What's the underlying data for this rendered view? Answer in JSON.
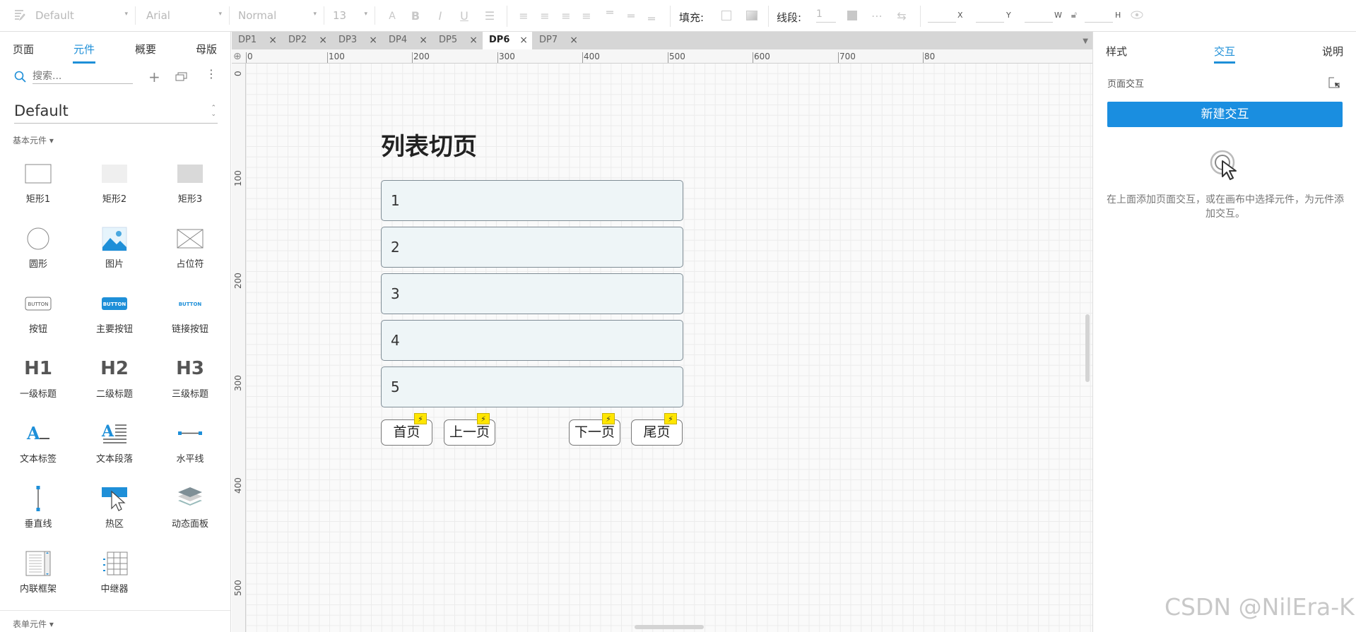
{
  "toolbar": {
    "style_value": "Default",
    "font_value": "Arial",
    "weight_value": "Normal",
    "size_value": "13",
    "fill_label": "填充:",
    "line_label": "线段:",
    "line_value": "1",
    "x_label": "X",
    "y_label": "Y",
    "w_label": "W",
    "h_label": "H"
  },
  "left": {
    "tabs": [
      {
        "label": "页面"
      },
      {
        "label": "元件"
      },
      {
        "label": "概要"
      },
      {
        "label": "母版"
      }
    ],
    "search_placeholder": "搜索...",
    "library_name": "Default",
    "section_basic": "基本元件 ▾",
    "section_form": "表单元件 ▾",
    "widgets": [
      {
        "label": "矩形1",
        "icon": "rect1-icon"
      },
      {
        "label": "矩形2",
        "icon": "rect2-icon"
      },
      {
        "label": "矩形3",
        "icon": "rect3-icon"
      },
      {
        "label": "圆形",
        "icon": "circle-icon"
      },
      {
        "label": "图片",
        "icon": "image-icon"
      },
      {
        "label": "占位符",
        "icon": "placeholder-icon"
      },
      {
        "label": "按钮",
        "icon": "button-icon",
        "glyph": "BUTTON"
      },
      {
        "label": "主要按钮",
        "icon": "primary-button-icon",
        "glyph": "BUTTON"
      },
      {
        "label": "链接按钮",
        "icon": "link-button-icon",
        "glyph": "BUTTON"
      },
      {
        "label": "一级标题",
        "icon": "h1-icon",
        "glyph": "H1"
      },
      {
        "label": "二级标题",
        "icon": "h2-icon",
        "glyph": "H2"
      },
      {
        "label": "三级标题",
        "icon": "h3-icon",
        "glyph": "H3"
      },
      {
        "label": "文本标签",
        "icon": "text-label-icon"
      },
      {
        "label": "文本段落",
        "icon": "text-paragraph-icon"
      },
      {
        "label": "水平线",
        "icon": "horizontal-line-icon"
      },
      {
        "label": "垂直线",
        "icon": "vertical-line-icon"
      },
      {
        "label": "热区",
        "icon": "hotspot-icon"
      },
      {
        "label": "动态面板",
        "icon": "dynamic-panel-icon"
      },
      {
        "label": "内联框架",
        "icon": "inline-frame-icon"
      },
      {
        "label": "中继器",
        "icon": "repeater-icon"
      }
    ]
  },
  "canvas": {
    "tabs": [
      {
        "label": "DP1"
      },
      {
        "label": "DP2"
      },
      {
        "label": "DP3"
      },
      {
        "label": "DP4"
      },
      {
        "label": "DP5"
      },
      {
        "label": "DP6"
      },
      {
        "label": "DP7"
      }
    ],
    "ruler_top": [
      "0",
      "100",
      "200",
      "300",
      "400",
      "500",
      "600",
      "700",
      "80"
    ],
    "ruler_left": [
      "0",
      "100",
      "200",
      "300",
      "400",
      "500"
    ],
    "title": "列表切页",
    "rows": [
      "1",
      "2",
      "3",
      "4",
      "5"
    ],
    "buttons": {
      "first": "首页",
      "prev": "上一页",
      "next": "下一页",
      "last": "尾页"
    }
  },
  "right": {
    "tabs": [
      {
        "label": "样式"
      },
      {
        "label": "交互"
      },
      {
        "label": "说明"
      }
    ],
    "section_label": "页面交互",
    "new_button": "新建交互",
    "hint": "在上面添加页面交互，或在画布中选择元件，为元件添加交互。"
  },
  "watermark": "CSDN @NilEra-K",
  "colors": {
    "accent": "#1e8fd8",
    "button_blue": "#1a8ee0",
    "bolt": "#ffe600"
  }
}
